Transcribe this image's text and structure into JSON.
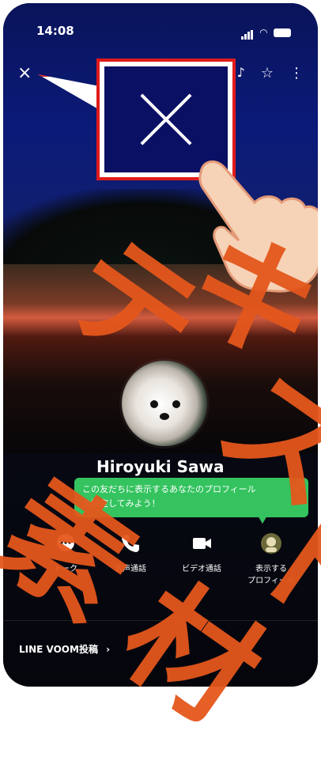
{
  "status_bar": {
    "time": "14:08"
  },
  "top_bar": {
    "close_icon": "close-icon",
    "icons": [
      "music-icon",
      "star-icon",
      "more-icon"
    ]
  },
  "callout": {
    "icon": "close-icon"
  },
  "profile": {
    "name": "Hiroyuki Sawa"
  },
  "banner": {
    "text_line1": "この友だちに表示するあなたのプロフィール",
    "text_line2": "を設定してみよう！",
    "close": "×"
  },
  "actions": [
    {
      "label": "トーク",
      "icon": "chat-icon"
    },
    {
      "label": "音声通話",
      "icon": "phone-icon"
    },
    {
      "label": "ビデオ通話",
      "icon": "video-icon"
    },
    {
      "label_line1": "表示する",
      "label_line2": "プロフィール",
      "icon": "profile-avatar-icon"
    }
  ],
  "footer": {
    "voom_label": "LINE VOOM投稿",
    "chevron": "›"
  },
  "watermark": {
    "chars": [
      "テ",
      "キ",
      "ス",
      "ト",
      "素",
      "材"
    ],
    "color": "#e4571c"
  },
  "colors": {
    "callout_border": "#e01b1b",
    "banner_bg": "#34c35f",
    "watermark": "#e4571c"
  }
}
